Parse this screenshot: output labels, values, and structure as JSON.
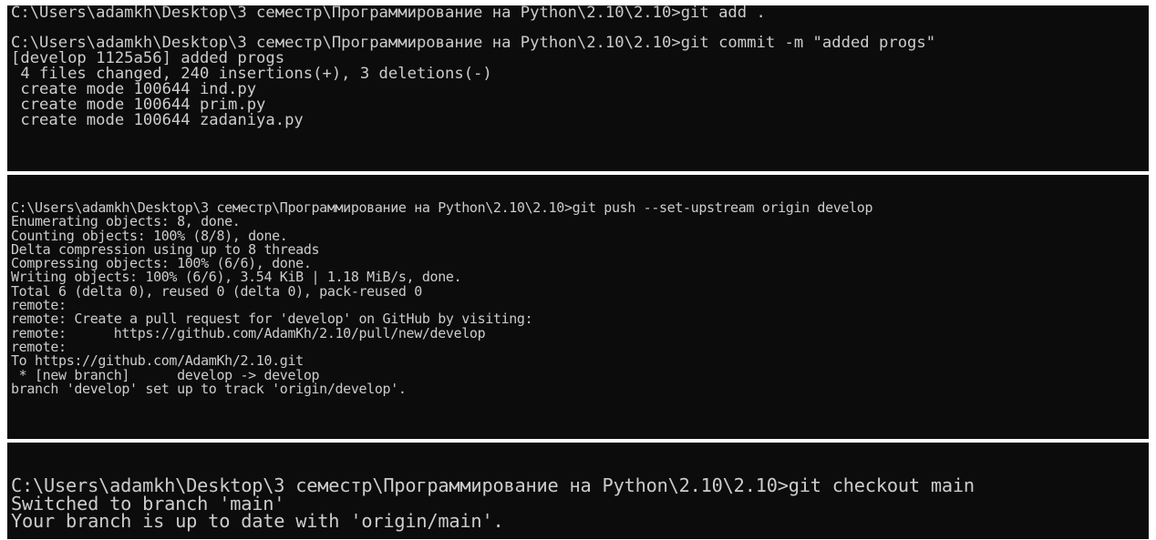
{
  "terminal1": {
    "lines": [
      "C:\\Users\\adamkh\\Desktop\\3 семестр\\Программирование на Python\\2.10\\2.10>git add .",
      "",
      "C:\\Users\\adamkh\\Desktop\\3 семестр\\Программирование на Python\\2.10\\2.10>git commit -m \"added progs\"",
      "[develop 1125a56] added progs",
      " 4 files changed, 240 insertions(+), 3 deletions(-)",
      " create mode 100644 ind.py",
      " create mode 100644 prim.py",
      " create mode 100644 zadaniya.py"
    ]
  },
  "terminal2": {
    "lines": [
      "C:\\Users\\adamkh\\Desktop\\3 семестр\\Программирование на Python\\2.10\\2.10>git push --set-upstream origin develop",
      "Enumerating objects: 8, done.",
      "Counting objects: 100% (8/8), done.",
      "Delta compression using up to 8 threads",
      "Compressing objects: 100% (6/6), done.",
      "Writing objects: 100% (6/6), 3.54 KiB | 1.18 MiB/s, done.",
      "Total 6 (delta 0), reused 0 (delta 0), pack-reused 0",
      "remote:",
      "remote: Create a pull request for 'develop' on GitHub by visiting:",
      "remote:      https://github.com/AdamKh/2.10/pull/new/develop",
      "remote:",
      "To https://github.com/AdamKh/2.10.git",
      " * [new branch]      develop -> develop",
      "branch 'develop' set up to track 'origin/develop'."
    ]
  },
  "terminal3": {
    "lines": [
      "C:\\Users\\adamkh\\Desktop\\3 семестр\\Программирование на Python\\2.10\\2.10>git checkout main",
      "Switched to branch 'main'",
      "Your branch is up to date with 'origin/main'."
    ]
  }
}
